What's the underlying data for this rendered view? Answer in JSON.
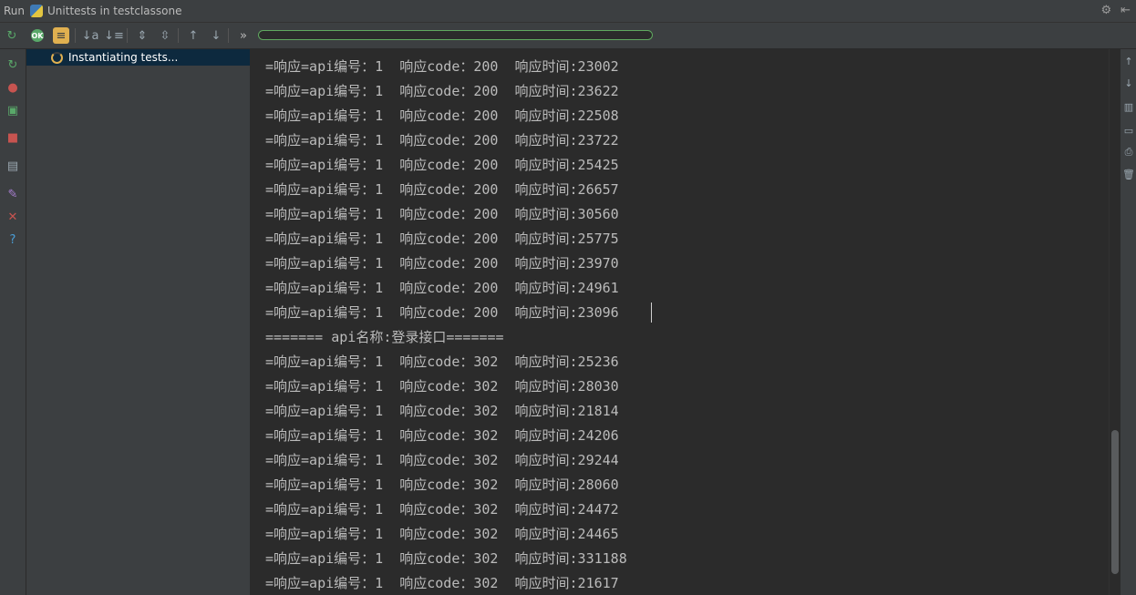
{
  "window": {
    "run_label": "Run",
    "title": "Unittests in testclassone",
    "settings_glyph": "⚙",
    "hide_glyph": "⇤"
  },
  "toolbar": {
    "progress_fraction": 0.0,
    "buttons": [
      {
        "icon": "rerun-icon",
        "glyph": "↻",
        "color": "#59a869"
      },
      {
        "icon": "ok-filter-icon",
        "glyph": "OK",
        "color": "#59a869"
      },
      {
        "icon": "show-ignored-icon",
        "glyph": "≡",
        "color": "#e0b050"
      },
      {
        "icon": "sort-alpha-icon",
        "glyph": "↓a",
        "color": "#9aa7b0"
      },
      {
        "icon": "sort-duration-icon",
        "glyph": "↓≡",
        "color": "#9aa7b0"
      },
      {
        "icon": "expand-all-icon",
        "glyph": "⇕",
        "color": "#9aa7b0"
      },
      {
        "icon": "collapse-all-icon",
        "glyph": "⇳",
        "color": "#9aa7b0"
      },
      {
        "icon": "prev-failed-icon",
        "glyph": "↑",
        "color": "#9aa7b0"
      },
      {
        "icon": "next-failed-icon",
        "glyph": "↓",
        "color": "#9aa7b0"
      },
      {
        "icon": "more-icon",
        "glyph": "»",
        "color": "#bbbbbb"
      }
    ]
  },
  "leftstrip": [
    {
      "icon": "rerun-icon",
      "glyph": "↻",
      "color": "#59a869"
    },
    {
      "icon": "rerun-failed-icon",
      "glyph": "●",
      "color": "#c75450"
    },
    {
      "icon": "toggle-autotest-icon",
      "glyph": "▣",
      "color": "#59a869"
    },
    {
      "icon": "stop-icon",
      "glyph": "■",
      "color": "#c75450"
    },
    {
      "icon": "layout-icon",
      "glyph": "▤",
      "color": "#9aa7b0"
    },
    {
      "icon": "pin-icon",
      "glyph": "✎",
      "color": "#a87fd1"
    },
    {
      "icon": "close-icon",
      "glyph": "✕",
      "color": "#c75450"
    },
    {
      "icon": "help-icon",
      "glyph": "?",
      "color": "#4a9ed6"
    }
  ],
  "tree": {
    "status_label": "Instantiating tests..."
  },
  "console": {
    "lines": [
      "=响应=api编号：1  响应code：200  响应时间:23002",
      "=响应=api编号：1  响应code：200  响应时间:23622",
      "=响应=api编号：1  响应code：200  响应时间:22508",
      "=响应=api编号：1  响应code：200  响应时间:23722",
      "=响应=api编号：1  响应code：200  响应时间:25425",
      "=响应=api编号：1  响应code：200  响应时间:26657",
      "=响应=api编号：1  响应code：200  响应时间:30560",
      "=响应=api编号：1  响应code：200  响应时间:25775",
      "=响应=api编号：1  响应code：200  响应时间:23970",
      "=响应=api编号：1  响应code：200  响应时间:24961",
      "=响应=api编号：1  响应code：200  响应时间:23096",
      "======= api名称:登录接口=======",
      "=响应=api编号：1  响应code：302  响应时间:25236",
      "=响应=api编号：1  响应code：302  响应时间:28030",
      "=响应=api编号：1  响应code：302  响应时间:21814",
      "=响应=api编号：1  响应code：302  响应时间:24206",
      "=响应=api编号：1  响应code：302  响应时间:29244",
      "=响应=api编号：1  响应code：302  响应时间:28060",
      "=响应=api编号：1  响应code：302  响应时间:24472",
      "=响应=api编号：1  响应code：302  响应时间:24465",
      "=响应=api编号：1  响应code：302  响应时间:331188",
      "=响应=api编号：1  响应code：302  响应时间:21617"
    ]
  },
  "rightstrip": [
    {
      "icon": "scroll-up-icon",
      "glyph": "↑"
    },
    {
      "icon": "scroll-down-icon",
      "glyph": "↓"
    },
    {
      "icon": "soft-wrap-icon",
      "glyph": "▥"
    },
    {
      "icon": "scroll-to-end-icon",
      "glyph": "▭"
    },
    {
      "icon": "print-icon",
      "glyph": "⎙"
    },
    {
      "icon": "clear-all-icon",
      "glyph": "🗑"
    }
  ]
}
